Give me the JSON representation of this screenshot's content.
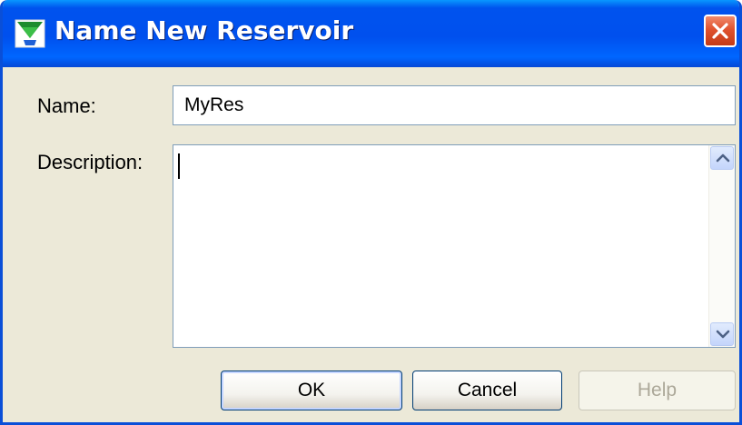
{
  "window": {
    "title": "Name New Reservoir",
    "icon": "reservoir-app-icon",
    "close_icon": "close-icon"
  },
  "form": {
    "name_label": "Name:",
    "name_value": "MyRes",
    "description_label": "Description:",
    "description_value": ""
  },
  "buttons": {
    "ok_label": "OK",
    "cancel_label": "Cancel",
    "help_label": "Help",
    "help_enabled": false
  },
  "colors": {
    "titlebar": "#0053ee",
    "window_bg": "#ece9d8",
    "close_button": "#e0522e",
    "disabled_text": "#aca899"
  }
}
